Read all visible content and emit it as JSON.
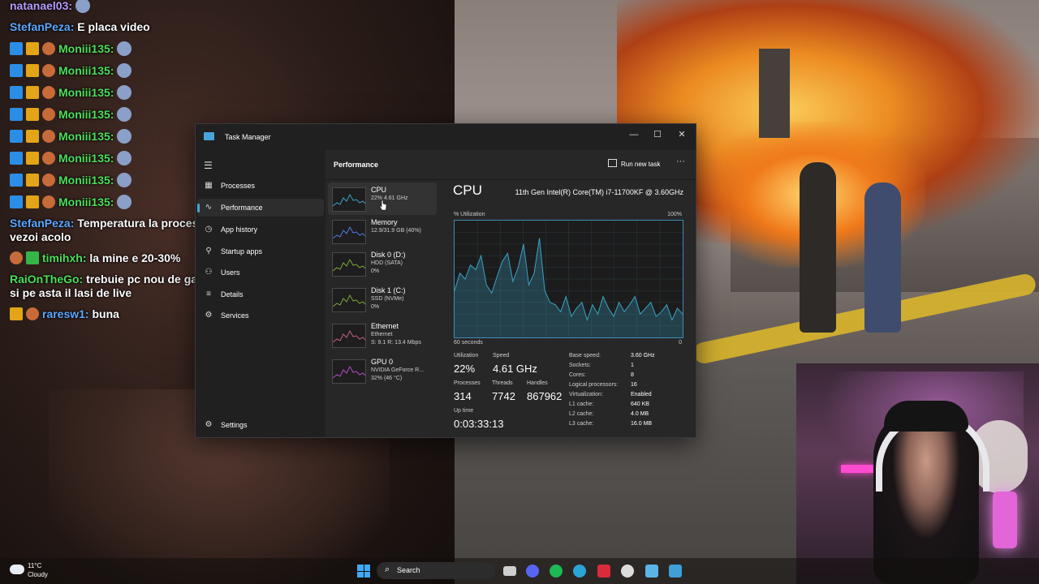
{
  "chat": [
    {
      "user": "natanael03:",
      "msg": "",
      "user_color": "purple",
      "badges": [],
      "emote": true
    },
    {
      "user": "StefanPeza:",
      "msg": "E placa video",
      "user_color": "blue",
      "badges": [],
      "emote": false
    },
    {
      "user": "Moniii135:",
      "msg": "",
      "user_color": "green",
      "badges": [
        "blue",
        "crown",
        "face"
      ],
      "emote": true
    },
    {
      "user": "Moniii135:",
      "msg": "",
      "user_color": "green",
      "badges": [
        "blue",
        "crown",
        "face"
      ],
      "emote": true
    },
    {
      "user": "Moniii135:",
      "msg": "",
      "user_color": "green",
      "badges": [
        "blue",
        "crown",
        "face"
      ],
      "emote": true
    },
    {
      "user": "Moniii135:",
      "msg": "",
      "user_color": "green",
      "badges": [
        "blue",
        "crown",
        "face"
      ],
      "emote": true
    },
    {
      "user": "Moniii135:",
      "msg": "",
      "user_color": "green",
      "badges": [
        "blue",
        "crown",
        "face"
      ],
      "emote": true
    },
    {
      "user": "Moniii135:",
      "msg": "",
      "user_color": "green",
      "badges": [
        "blue",
        "crown",
        "face"
      ],
      "emote": true
    },
    {
      "user": "Moniii135:",
      "msg": "",
      "user_color": "green",
      "badges": [
        "blue",
        "crown",
        "face"
      ],
      "emote": true
    },
    {
      "user": "Moniii135:",
      "msg": "",
      "user_color": "green",
      "badges": [
        "blue",
        "crown",
        "face"
      ],
      "emote": true
    },
    {
      "user": "StefanPeza:",
      "msg": "Temperatura la procesor nu o vezoi acolo",
      "user_color": "blue",
      "badges": [],
      "emote": false
    },
    {
      "user": "timihxh:",
      "msg": "la mine e 20-30%",
      "user_color": "green",
      "badges": [
        "face",
        "green"
      ],
      "emote": false
    },
    {
      "user": "RaiOnTheGo:",
      "msg": "trebuie pc nou de gaming si pe asta il lasi de live",
      "user_color": "green",
      "badges": [],
      "emote": false
    },
    {
      "user": "raresw1:",
      "msg": "buna",
      "user_color": "blue",
      "badges": [
        "crown",
        "face"
      ],
      "emote": false
    }
  ],
  "window": {
    "title": "Task Manager",
    "minimize_icon": "minimize-icon",
    "maximize_icon": "maximize-icon",
    "close_icon": "close-icon"
  },
  "nav": {
    "items": [
      {
        "label": "Processes",
        "icon": "grid-icon"
      },
      {
        "label": "Performance",
        "icon": "performance-icon"
      },
      {
        "label": "App history",
        "icon": "history-icon"
      },
      {
        "label": "Startup apps",
        "icon": "startup-icon"
      },
      {
        "label": "Users",
        "icon": "users-icon"
      },
      {
        "label": "Details",
        "icon": "list-icon"
      },
      {
        "label": "Services",
        "icon": "puzzle-icon"
      }
    ],
    "settings": "Settings"
  },
  "header": {
    "title": "Performance",
    "run_new_task": "Run new task",
    "more": "···"
  },
  "resources": [
    {
      "name": "CPU",
      "sub1": "22% 4.61 GHz",
      "sub2": "",
      "color": "#3aa3c7"
    },
    {
      "name": "Memory",
      "sub1": "12.9/31.9 GB (40%)",
      "sub2": "",
      "color": "#4f7ae0"
    },
    {
      "name": "Disk 0 (D:)",
      "sub1": "HDD (SATA)",
      "sub2": "0%",
      "color": "#7da63a"
    },
    {
      "name": "Disk 1 (C:)",
      "sub1": "SSD (NVMe)",
      "sub2": "0%",
      "color": "#7da63a"
    },
    {
      "name": "Ethernet",
      "sub1": "Ethernet",
      "sub2": "S: 9.1 R: 13.4 Mbps",
      "color": "#c85a8a"
    },
    {
      "name": "GPU 0",
      "sub1": "NVIDIA GeForce R...",
      "sub2": "32% (46 °C)",
      "color": "#b44ec8"
    }
  ],
  "cpu": {
    "title": "CPU",
    "model": "11th Gen Intel(R) Core(TM) i7-11700KF @ 3.60GHz",
    "util_label": "% Utilization",
    "util_max": "100%",
    "time_left": "60 seconds",
    "time_right": "0",
    "history": [
      40,
      55,
      50,
      62,
      58,
      70,
      45,
      38,
      52,
      65,
      72,
      48,
      60,
      80,
      45,
      55,
      85,
      40,
      30,
      28,
      22,
      35,
      18,
      25,
      30,
      15,
      28,
      20,
      35,
      25,
      18,
      30,
      22,
      28,
      35,
      20,
      25,
      30,
      18,
      22,
      28,
      15,
      25,
      20
    ],
    "stats": {
      "utilization_label": "Utilization",
      "utilization": "22%",
      "speed_label": "Speed",
      "speed": "4.61 GHz",
      "processes_label": "Processes",
      "processes": "314",
      "threads_label": "Threads",
      "threads": "7742",
      "handles_label": "Handles",
      "handles": "867962",
      "uptime_label": "Up time",
      "uptime": "0:03:33:13"
    },
    "specs": [
      {
        "k": "Base speed:",
        "v": "3.60 GHz"
      },
      {
        "k": "Sockets:",
        "v": "1"
      },
      {
        "k": "Cores:",
        "v": "8"
      },
      {
        "k": "Logical processors:",
        "v": "16"
      },
      {
        "k": "Virtualization:",
        "v": "Enabled"
      },
      {
        "k": "L1 cache:",
        "v": "640 KB"
      },
      {
        "k": "L2 cache:",
        "v": "4.0 MB"
      },
      {
        "k": "L3 cache:",
        "v": "16.0 MB"
      }
    ]
  },
  "taskbar": {
    "temp": "11°C",
    "condition": "Cloudy",
    "search_placeholder": "Search",
    "apps": [
      "file-explorer-icon",
      "discord-icon",
      "spotify-icon",
      "edge-icon",
      "red-app-icon",
      "browser-icon",
      "window-app-icon",
      "task-manager-icon"
    ]
  }
}
